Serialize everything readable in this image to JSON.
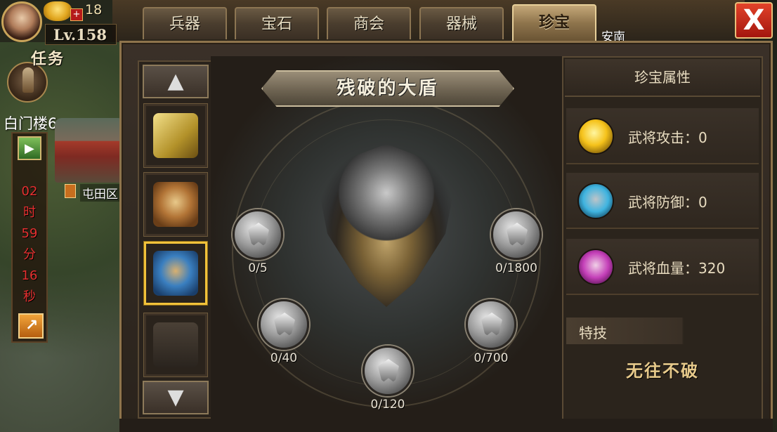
{
  "hud": {
    "gold_count": "18",
    "level": "Lv.158",
    "task_label": "任务",
    "city": "白门楼6",
    "timer": [
      "02",
      "时",
      "59",
      "分",
      "16",
      "秒"
    ],
    "field_label": "屯田区",
    "top_right_text": "安南"
  },
  "tabs": [
    {
      "label": "兵器",
      "active": false
    },
    {
      "label": "宝石",
      "active": false
    },
    {
      "label": "商会",
      "active": false
    },
    {
      "label": "器械",
      "active": false
    },
    {
      "label": "珍宝",
      "active": true
    }
  ],
  "close_label": "X",
  "treasure": {
    "name": "残破的大盾",
    "gems": [
      {
        "count": "0/5"
      },
      {
        "count": "0/40"
      },
      {
        "count": "0/120"
      },
      {
        "count": "0/700"
      },
      {
        "count": "0/1800"
      }
    ]
  },
  "item_list": {
    "up_arrow": "▲",
    "down_arrow": "▼",
    "slots": [
      {
        "icon": "book-icon",
        "selected": false
      },
      {
        "icon": "beast-shield-gold-icon",
        "selected": false
      },
      {
        "icon": "beast-shield-blue-icon",
        "selected": true
      },
      {
        "icon": "chest-icon",
        "selected": false
      }
    ]
  },
  "attributes": {
    "title": "珍宝属性",
    "rows": [
      {
        "label": "武将攻击：0",
        "icon": "attack-icon",
        "color": "#f5c21a"
      },
      {
        "label": "武将防御：0",
        "icon": "defense-icon",
        "color": "#3fb4e0"
      },
      {
        "label": "武将血量：320",
        "icon": "health-icon",
        "color": "#c43fb8"
      }
    ],
    "skill_title": "特技",
    "skill_value": "无往不破"
  }
}
